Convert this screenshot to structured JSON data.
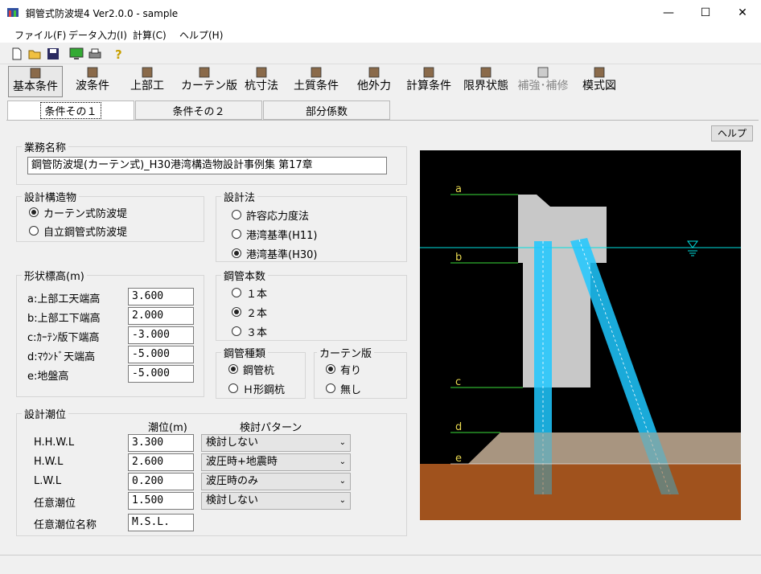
{
  "window": {
    "title": "鋼管式防波堤4 Ver2.0.0 - sample",
    "minimize": "—",
    "maximize": "☐",
    "close": "✕"
  },
  "menu": [
    "ファイル(F)",
    "データ入力(I)",
    "計算(C)",
    "ヘルプ(H)"
  ],
  "toolbar_icons": [
    "new-file-icon",
    "open-folder-icon",
    "save-icon",
    "calc-monitor-icon",
    "print-icon",
    "help-question-icon"
  ],
  "main_buttons": [
    {
      "label": "基本条件",
      "icon": "basic-conditions-icon",
      "active": true
    },
    {
      "label": "波条件",
      "icon": "wave-icon"
    },
    {
      "label": "上部工",
      "icon": "superstructure-icon"
    },
    {
      "label": "カーテン版",
      "icon": "curtain-icon"
    },
    {
      "label": "杭寸法",
      "icon": "pile-size-icon"
    },
    {
      "label": "土質条件",
      "icon": "soil-icon"
    },
    {
      "label": "他外力",
      "icon": "external-force-icon"
    },
    {
      "label": "計算条件",
      "icon": "calc-conditions-icon"
    },
    {
      "label": "限界状態",
      "icon": "limit-state-icon"
    },
    {
      "label": "補強･補修",
      "icon": "reinforce-icon",
      "disabled": true
    },
    {
      "label": "模式図",
      "icon": "schematic-icon"
    }
  ],
  "tabs": [
    "条件その１",
    "条件その２",
    "部分係数"
  ],
  "help_button": "ヘルプ",
  "project": {
    "title": "業務名称",
    "value": "鋼管防波堤(カーテン式)_H30港湾構造物設計事例集 第17章"
  },
  "structure": {
    "title": "設計構造物",
    "options": [
      "カーテン式防波堤",
      "自立鋼管式防波堤"
    ],
    "selected": 0
  },
  "method": {
    "title": "設計法",
    "options": [
      "許容応力度法",
      "港湾基準(H11)",
      "港湾基準(H30)"
    ],
    "selected": 2
  },
  "elevations": {
    "title": "形状標高(m)",
    "rows": [
      {
        "label": "a:上部工天端高",
        "value": "3.600"
      },
      {
        "label": "b:上部工下端高",
        "value": "2.000"
      },
      {
        "label": "c:ｶｰﾃﾝ版下端高",
        "value": "-3.000"
      },
      {
        "label": "d:ﾏｳﾝﾄﾞ天端高",
        "value": "-5.000"
      },
      {
        "label": "e:地盤高",
        "value": "-5.000"
      }
    ]
  },
  "pile_count": {
    "title": "鋼管本数",
    "options": [
      "１本",
      "２本",
      "３本"
    ],
    "selected": 1
  },
  "pile_type": {
    "title": "鋼管種類",
    "options": [
      "鋼管杭",
      "Ｈ形鋼杭"
    ],
    "selected": 0
  },
  "curtain": {
    "title": "カーテン版",
    "options": [
      "有り",
      "無し"
    ],
    "selected": 0
  },
  "tide": {
    "title": "設計潮位",
    "col_level": "潮位(m)",
    "col_pattern": "検討パターン",
    "rows": [
      {
        "label": "H.H.W.L",
        "value": "3.300",
        "pattern": "検討しない"
      },
      {
        "label": "H.W.L",
        "value": "2.600",
        "pattern": "波圧時+地震時"
      },
      {
        "label": "L.W.L",
        "value": "0.200",
        "pattern": "波圧時のみ"
      },
      {
        "label": "任意潮位",
        "value": "1.500",
        "pattern": "検討しない"
      }
    ],
    "name_label": "任意潮位名称",
    "name_value": "M.S.L."
  },
  "diagram_labels": {
    "a": "a",
    "b": "b",
    "c": "c",
    "d": "d",
    "e": "e"
  },
  "colors": {
    "sea": "#00e0e0",
    "seabed": "#a0521e",
    "mound": "#a89580",
    "pile": "#1ec8ff",
    "structure": "#c8c8c8"
  }
}
